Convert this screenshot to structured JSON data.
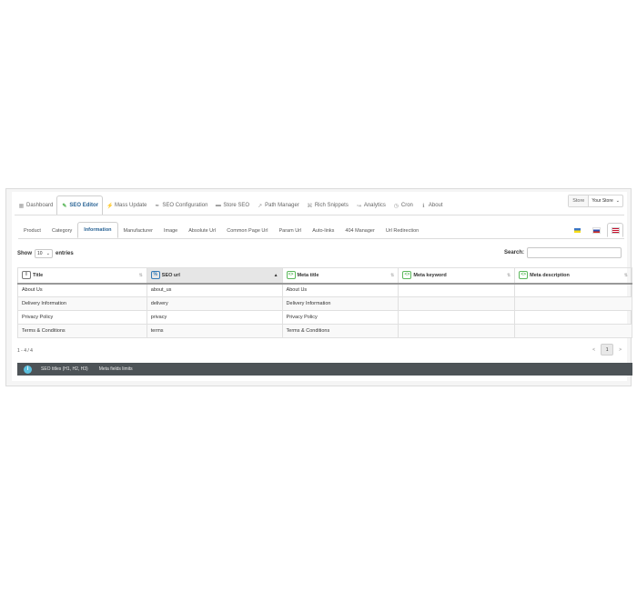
{
  "nav": {
    "tabs": [
      {
        "label": "Dashboard",
        "icon": "dashboard-icon"
      },
      {
        "label": "SEO Editor",
        "icon": "edit-icon"
      },
      {
        "label": "Mass Update",
        "icon": "mass-update-icon"
      },
      {
        "label": "SEO Configuration",
        "icon": "wrench-icon"
      },
      {
        "label": "Store SEO",
        "icon": "store-icon"
      },
      {
        "label": "Path Manager",
        "icon": "path-icon"
      },
      {
        "label": "Rich Snippets",
        "icon": "snippets-icon"
      },
      {
        "label": "Analytics",
        "icon": "analytics-icon"
      },
      {
        "label": "Cron",
        "icon": "clock-icon"
      },
      {
        "label": "About",
        "icon": "info-icon"
      }
    ],
    "active_index": 1
  },
  "store": {
    "label": "Store",
    "value": "Your Store"
  },
  "subtabs": {
    "items": [
      "Product",
      "Category",
      "Information",
      "Manufacturer",
      "Image",
      "Absolute Url",
      "Common Page Url",
      "Param Url",
      "Auto-links",
      "404 Manager",
      "Url Redirection"
    ],
    "active_index": 2
  },
  "languages": [
    "ua",
    "ru",
    "en"
  ],
  "controls": {
    "show_label": "Show",
    "entries_value": "10",
    "entries_label": "entries",
    "search_label": "Search:",
    "search_value": ""
  },
  "table": {
    "columns": [
      {
        "label": "Title",
        "icon": "title-icon"
      },
      {
        "label": "SEO url",
        "icon": "link-icon"
      },
      {
        "label": "Meta title",
        "icon": "meta-title-icon"
      },
      {
        "label": "Meta keyword",
        "icon": "meta-keyword-icon"
      },
      {
        "label": "Meta description",
        "icon": "meta-description-icon"
      }
    ],
    "rows": [
      [
        "About Us",
        "about_us",
        "About Us",
        "",
        ""
      ],
      [
        "Delivery Information",
        "delivery",
        "Delivery Information",
        "",
        ""
      ],
      [
        "Privacy Policy",
        "privacy",
        "Privacy Policy",
        "",
        ""
      ],
      [
        "Terms & Conditions",
        "terms",
        "Terms & Conditions",
        "",
        ""
      ]
    ]
  },
  "pagination": {
    "info": "1 - 4 / 4",
    "prev": "<",
    "page": "1",
    "next": ">"
  },
  "footer": {
    "links": [
      "SEO titles (H1, H2, H3)",
      "Meta fields limits"
    ]
  },
  "colors": {
    "accent": "#5cb85c",
    "link": "#2a6496",
    "footer_bg": "#4d5357",
    "info_icon": "#5bc0de"
  }
}
